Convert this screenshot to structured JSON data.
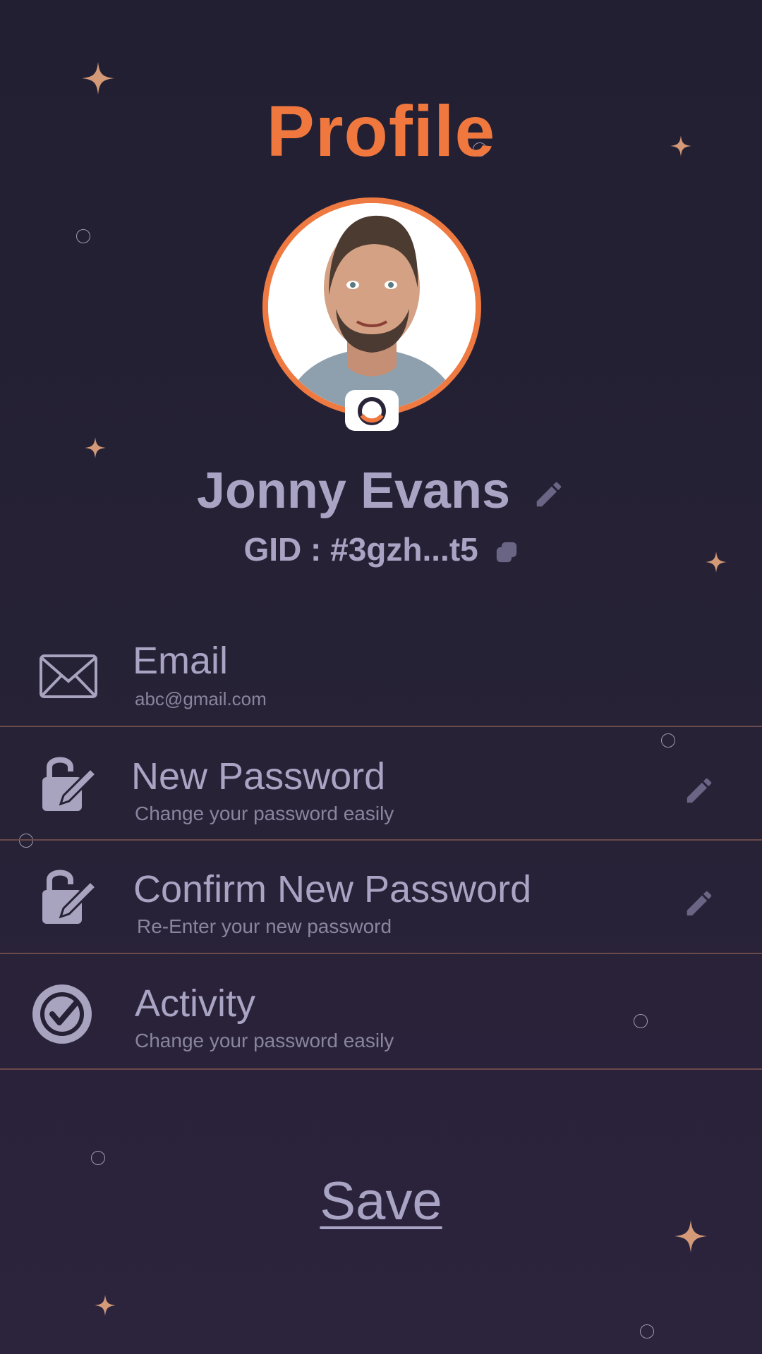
{
  "header": {
    "title": "Profile"
  },
  "profile": {
    "name": "Jonny Evans",
    "gid": "GID : #3gzh...t5"
  },
  "settings": [
    {
      "label": "Email",
      "subtitle": "abc@gmail.com",
      "icon": "envelope-icon",
      "editable": false
    },
    {
      "label": "New Password",
      "subtitle": "Change your password easily",
      "icon": "lock-edit-icon",
      "editable": true
    },
    {
      "label": "Confirm New Password",
      "subtitle": "Re-Enter your new password",
      "icon": "lock-edit-icon",
      "editable": true
    },
    {
      "label": "Activity",
      "subtitle": "Change your password easily",
      "icon": "check-circle-icon",
      "editable": false
    }
  ],
  "actions": {
    "save_label": "Save"
  },
  "colors": {
    "accent": "#f0783e",
    "text": "#aaa4c4",
    "background": "#221f33",
    "divider": "#6a4a4a",
    "sparkle": "#d49a78"
  }
}
